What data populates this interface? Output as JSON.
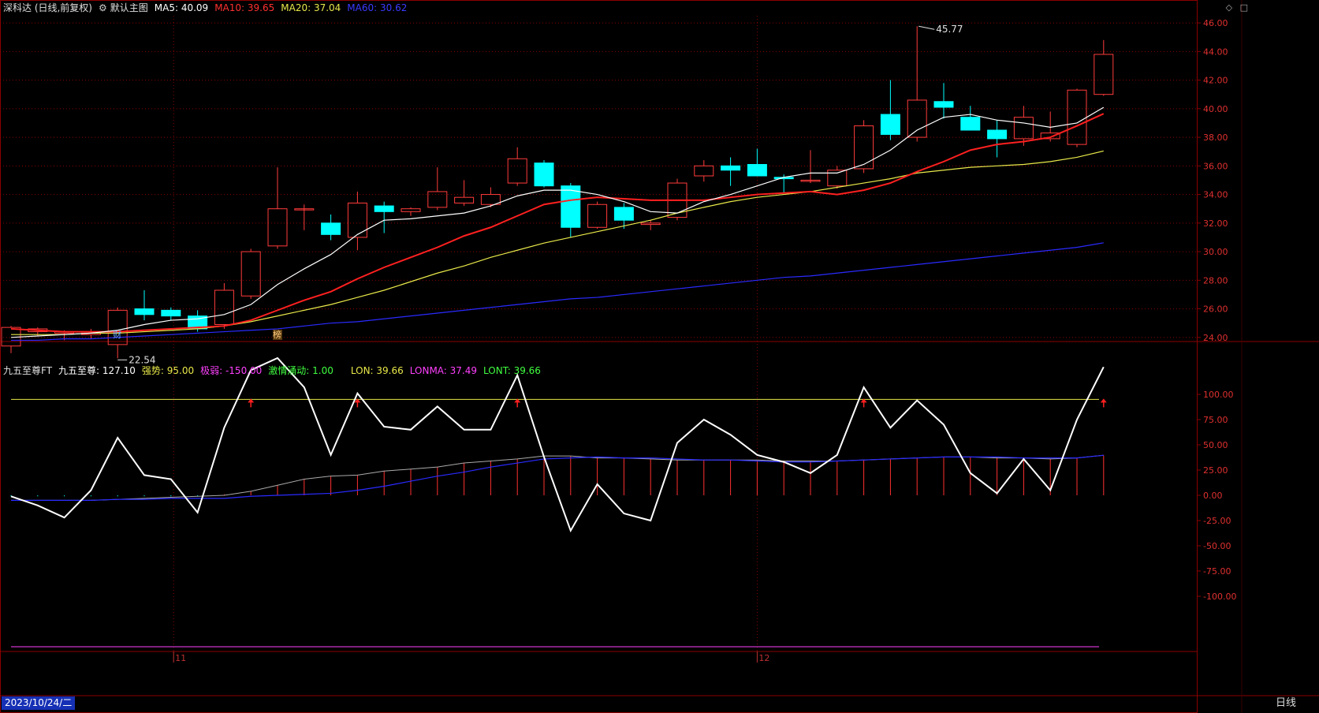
{
  "header": {
    "stock_name": "深科达 (日线,前复权)",
    "main_chart_label": "默认主图",
    "ma5": "MA5: 40.09",
    "ma10": "MA10: 39.65",
    "ma20": "MA20: 37.04",
    "ma60": "MA60: 30.62"
  },
  "indicator_header": {
    "name": "九五至尊FT",
    "value": "九五至尊: 127.10",
    "strength": "强势: 95.00",
    "extreme_weak": "极弱: -150.00",
    "passion": "激情涌动: 1.00",
    "lon": "LON: 39.66",
    "lonma": "LONMA: 37.49",
    "lont": "LONT: 39.66"
  },
  "colors": {
    "up": "#ff3b3b",
    "down": "#00ffff",
    "ma5": "#ffffff",
    "ma10": "#ff2020",
    "ma20": "#e8e84a",
    "ma60": "#2a2aff",
    "grid": "#8b0000"
  },
  "price_axis": {
    "labels": [
      "46.00",
      "44.00",
      "42.00",
      "40.00",
      "38.00",
      "36.00",
      "34.00",
      "32.00",
      "30.00",
      "28.00",
      "26.00",
      "24.00"
    ]
  },
  "indicator_axis": {
    "labels": [
      "100.00",
      "75.00",
      "50.00",
      "25.00",
      "0.00",
      "-25.00",
      "-50.00",
      "-75.00",
      "-100.00"
    ]
  },
  "annotations": {
    "high": "45.77",
    "low": "22.54",
    "marker_cai": "财",
    "marker_bang": "榜"
  },
  "time_axis": {
    "month_11": "11",
    "month_12": "12"
  },
  "footer": {
    "date_badge": "2023/10/24/二",
    "period": "日线"
  },
  "icons": [
    "diamond-icon",
    "square-icon"
  ],
  "chart_data": {
    "type": "candlestick",
    "price_ylim": [
      22.5,
      46.5
    ],
    "indicator_ylim": [
      -130,
      140
    ],
    "candles": [
      {
        "o": 23.4,
        "h": 24.8,
        "l": 22.9,
        "c": 24.7
      },
      {
        "o": 24.4,
        "h": 24.7,
        "l": 24.1,
        "c": 24.6
      },
      {
        "o": 24.3,
        "h": 24.5,
        "l": 23.8,
        "c": 24.4
      },
      {
        "o": 24.2,
        "h": 24.6,
        "l": 23.9,
        "c": 24.3
      },
      {
        "o": 23.5,
        "h": 26.1,
        "l": 22.54,
        "c": 25.9
      },
      {
        "o": 26.0,
        "h": 27.3,
        "l": 25.2,
        "c": 25.6
      },
      {
        "o": 25.9,
        "h": 26.1,
        "l": 25.2,
        "c": 25.5
      },
      {
        "o": 25.5,
        "h": 25.9,
        "l": 24.4,
        "c": 24.6
      },
      {
        "o": 24.9,
        "h": 27.8,
        "l": 24.6,
        "c": 27.3
      },
      {
        "o": 26.9,
        "h": 30.2,
        "l": 26.7,
        "c": 30.0
      },
      {
        "o": 30.4,
        "h": 35.9,
        "l": 30.2,
        "c": 33.0
      },
      {
        "o": 33.0,
        "h": 33.3,
        "l": 31.5,
        "c": 33.0
      },
      {
        "o": 32.0,
        "h": 32.6,
        "l": 30.8,
        "c": 31.2
      },
      {
        "o": 31.0,
        "h": 34.2,
        "l": 30.1,
        "c": 33.4
      },
      {
        "o": 33.2,
        "h": 33.5,
        "l": 31.3,
        "c": 32.8
      },
      {
        "o": 32.8,
        "h": 33.1,
        "l": 32.5,
        "c": 33.0
      },
      {
        "o": 33.1,
        "h": 35.9,
        "l": 32.9,
        "c": 34.2
      },
      {
        "o": 33.4,
        "h": 35.0,
        "l": 33.2,
        "c": 33.8
      },
      {
        "o": 33.3,
        "h": 34.5,
        "l": 33.1,
        "c": 34.0
      },
      {
        "o": 34.8,
        "h": 37.3,
        "l": 34.6,
        "c": 36.5
      },
      {
        "o": 36.2,
        "h": 36.4,
        "l": 34.5,
        "c": 34.6
      },
      {
        "o": 34.6,
        "h": 34.8,
        "l": 31.0,
        "c": 31.7
      },
      {
        "o": 31.7,
        "h": 33.5,
        "l": 31.6,
        "c": 33.3
      },
      {
        "o": 33.1,
        "h": 33.4,
        "l": 31.6,
        "c": 32.2
      },
      {
        "o": 31.9,
        "h": 32.2,
        "l": 31.5,
        "c": 32.0
      },
      {
        "o": 32.4,
        "h": 35.1,
        "l": 32.2,
        "c": 34.8
      },
      {
        "o": 35.3,
        "h": 36.4,
        "l": 34.9,
        "c": 36.0
      },
      {
        "o": 36.0,
        "h": 36.6,
        "l": 34.6,
        "c": 35.7
      },
      {
        "o": 36.1,
        "h": 37.2,
        "l": 35.8,
        "c": 35.3
      },
      {
        "o": 35.2,
        "h": 35.4,
        "l": 34.1,
        "c": 35.1
      },
      {
        "o": 35.0,
        "h": 37.1,
        "l": 34.8,
        "c": 35.0
      },
      {
        "o": 34.6,
        "h": 36.0,
        "l": 34.4,
        "c": 35.7
      },
      {
        "o": 35.8,
        "h": 39.2,
        "l": 35.5,
        "c": 38.8
      },
      {
        "o": 39.6,
        "h": 42.0,
        "l": 37.8,
        "c": 38.2
      },
      {
        "o": 38.0,
        "h": 45.77,
        "l": 37.7,
        "c": 40.6
      },
      {
        "o": 40.5,
        "h": 41.8,
        "l": 39.3,
        "c": 40.1
      },
      {
        "o": 39.4,
        "h": 40.2,
        "l": 38.6,
        "c": 38.5
      },
      {
        "o": 38.5,
        "h": 39.2,
        "l": 36.6,
        "c": 37.9
      },
      {
        "o": 37.9,
        "h": 40.2,
        "l": 37.4,
        "c": 39.4
      },
      {
        "o": 37.9,
        "h": 39.8,
        "l": 37.7,
        "c": 38.3
      },
      {
        "o": 37.5,
        "h": 41.4,
        "l": 37.3,
        "c": 41.3
      },
      {
        "o": 41.0,
        "h": 44.8,
        "l": 40.9,
        "c": 43.8
      }
    ],
    "ma5": [
      24.0,
      24.1,
      24.2,
      24.3,
      24.5,
      24.9,
      25.2,
      25.3,
      25.6,
      26.3,
      27.7,
      28.8,
      29.8,
      31.2,
      32.2,
      32.3,
      32.5,
      32.7,
      33.2,
      33.9,
      34.3,
      34.3,
      34.0,
      33.5,
      32.8,
      32.7,
      33.5,
      34.0,
      34.6,
      35.2,
      35.5,
      35.5,
      36.1,
      37.1,
      38.5,
      39.4,
      39.6,
      39.2,
      39.0,
      38.7,
      39.0,
      40.09
    ],
    "ma10": [
      24.6,
      24.5,
      24.4,
      24.4,
      24.4,
      24.5,
      24.6,
      24.7,
      24.8,
      25.2,
      25.9,
      26.6,
      27.2,
      28.1,
      28.9,
      29.6,
      30.3,
      31.1,
      31.7,
      32.5,
      33.3,
      33.6,
      33.8,
      33.7,
      33.6,
      33.6,
      33.6,
      33.8,
      34.0,
      34.1,
      34.2,
      34.0,
      34.3,
      34.8,
      35.6,
      36.3,
      37.1,
      37.5,
      37.7,
      38.0,
      38.8,
      39.65
    ],
    "ma20": [
      24.2,
      24.2,
      24.2,
      24.3,
      24.3,
      24.4,
      24.5,
      24.6,
      24.8,
      25.1,
      25.5,
      25.9,
      26.3,
      26.8,
      27.3,
      27.9,
      28.5,
      29.0,
      29.6,
      30.1,
      30.6,
      31.0,
      31.4,
      31.8,
      32.2,
      32.7,
      33.1,
      33.5,
      33.8,
      34.0,
      34.2,
      34.5,
      34.8,
      35.1,
      35.5,
      35.7,
      35.9,
      36.0,
      36.1,
      36.3,
      36.6,
      37.04
    ],
    "ma60": [
      23.8,
      23.8,
      23.9,
      23.9,
      24.0,
      24.1,
      24.2,
      24.3,
      24.4,
      24.5,
      24.6,
      24.8,
      25.0,
      25.1,
      25.3,
      25.5,
      25.7,
      25.9,
      26.1,
      26.3,
      26.5,
      26.7,
      26.8,
      27.0,
      27.2,
      27.4,
      27.6,
      27.8,
      28.0,
      28.2,
      28.3,
      28.5,
      28.7,
      28.9,
      29.1,
      29.3,
      29.5,
      29.7,
      29.9,
      30.1,
      30.3,
      30.62
    ],
    "indicator": [
      -1,
      -10,
      -22,
      5,
      57,
      20,
      16,
      -17,
      67,
      124,
      136,
      107,
      40,
      101,
      68,
      65,
      88,
      65,
      65,
      119,
      38,
      -35,
      11,
      -18,
      -25,
      52,
      75,
      60,
      40,
      33,
      22,
      40,
      107,
      67,
      94,
      70,
      22,
      2,
      36,
      5,
      75,
      127.1
    ],
    "lonma": [
      -5,
      -5,
      -5,
      -5,
      -4,
      -3,
      -2,
      -1,
      0,
      4,
      10,
      16,
      19,
      20,
      24,
      26,
      28,
      32,
      34,
      36,
      39,
      39,
      37,
      37,
      36,
      35,
      35,
      35,
      35,
      34,
      34,
      34,
      35,
      36,
      37,
      38,
      38,
      37,
      37,
      36,
      37,
      39.66
    ],
    "lon_blue": [
      -5,
      -5,
      -5,
      -5,
      -4,
      -4,
      -3,
      -3,
      -3,
      -1,
      0,
      1,
      2,
      5,
      9,
      14,
      19,
      23,
      28,
      32,
      36,
      37,
      38,
      37,
      37,
      36,
      35,
      35,
      34,
      33,
      33,
      34,
      35,
      36,
      37,
      38,
      38,
      38,
      37,
      37,
      37,
      39.66
    ],
    "lon_bars": [
      -1,
      -1,
      -1,
      -1,
      -1,
      -1,
      -1,
      -1,
      1,
      4,
      10,
      16,
      19,
      20,
      24,
      26,
      28,
      32,
      34,
      36,
      39,
      39,
      37,
      37,
      36,
      35,
      35,
      35,
      35,
      34,
      34,
      34,
      35,
      36,
      37,
      38,
      38,
      37,
      37,
      36,
      37,
      39.66
    ],
    "strong_level": 95,
    "signal_bars": [
      9,
      13,
      19,
      32,
      41
    ]
  }
}
